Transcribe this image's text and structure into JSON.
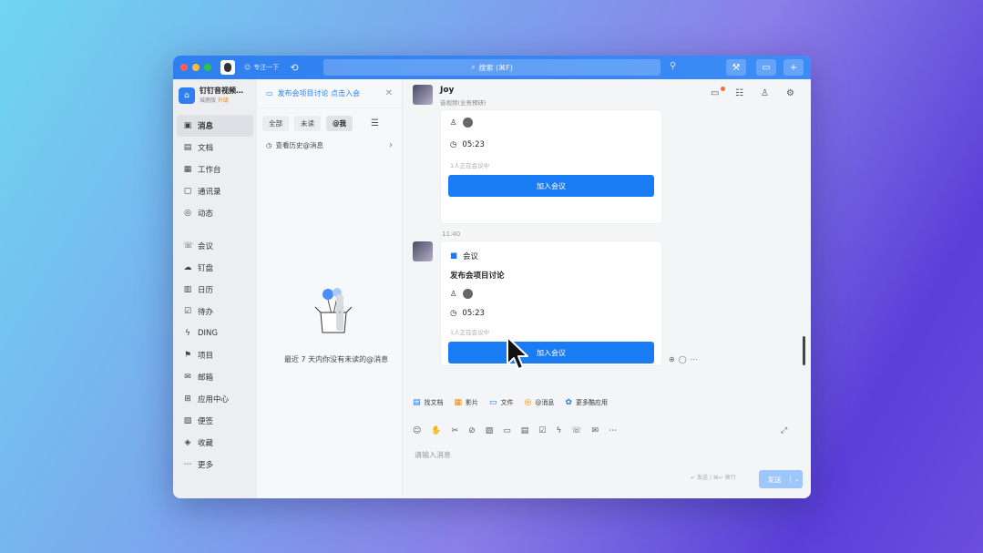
{
  "titlebar": {
    "status": "专注一下",
    "search_placeholder": "搜索 (⌘F)"
  },
  "org": {
    "name": "钉钉音视频…",
    "sub": "城鹿版",
    "tag": "升级"
  },
  "nav": {
    "items": [
      {
        "label": "消息",
        "icon": "message-icon"
      },
      {
        "label": "文档",
        "icon": "document-icon"
      },
      {
        "label": "工作台",
        "icon": "workbench-icon"
      },
      {
        "label": "通讯录",
        "icon": "contacts-icon"
      },
      {
        "label": "动态",
        "icon": "feed-icon"
      },
      {
        "label": "会议",
        "icon": "meeting-icon"
      },
      {
        "label": "钉盘",
        "icon": "cloud-drive-icon"
      },
      {
        "label": "日历",
        "icon": "calendar-icon"
      },
      {
        "label": "待办",
        "icon": "todo-icon"
      },
      {
        "label": "DING",
        "icon": "ding-icon"
      },
      {
        "label": "项目",
        "icon": "project-icon"
      },
      {
        "label": "邮箱",
        "icon": "mail-icon"
      },
      {
        "label": "应用中心",
        "icon": "app-center-icon"
      },
      {
        "label": "便签",
        "icon": "notes-icon"
      },
      {
        "label": "收藏",
        "icon": "favorites-icon"
      },
      {
        "label": "更多",
        "icon": "more-icon"
      }
    ]
  },
  "midpanel": {
    "banner": "发布会项目讨论 点击入会",
    "filters": [
      "全部",
      "未读",
      "@我"
    ],
    "history_link": "查看历史@消息",
    "empty_text": "最近 7 天内你没有未读的@消息"
  },
  "chat": {
    "name": "Joy",
    "subtitle": "音视频(业务预研)",
    "card1": {
      "duration": "05:23",
      "note": "1人正在会议中",
      "join": "加入会议"
    },
    "timestamp": "11:40",
    "card2": {
      "app": "会议",
      "title": "发布会项目讨论",
      "duration": "05:23",
      "note": "1人正在会议中",
      "join": "加入会议"
    },
    "quick_apps": [
      "找文档",
      "影片",
      "文件",
      "@消息",
      "更多酷应用"
    ],
    "input_placeholder": "请输入消息",
    "send_hint": "↵ 发送 / ⌘↵ 换行",
    "send_label": "发送"
  },
  "colors": {
    "accent": "#1a7cf5",
    "titlebar": "#2f7ff0"
  }
}
